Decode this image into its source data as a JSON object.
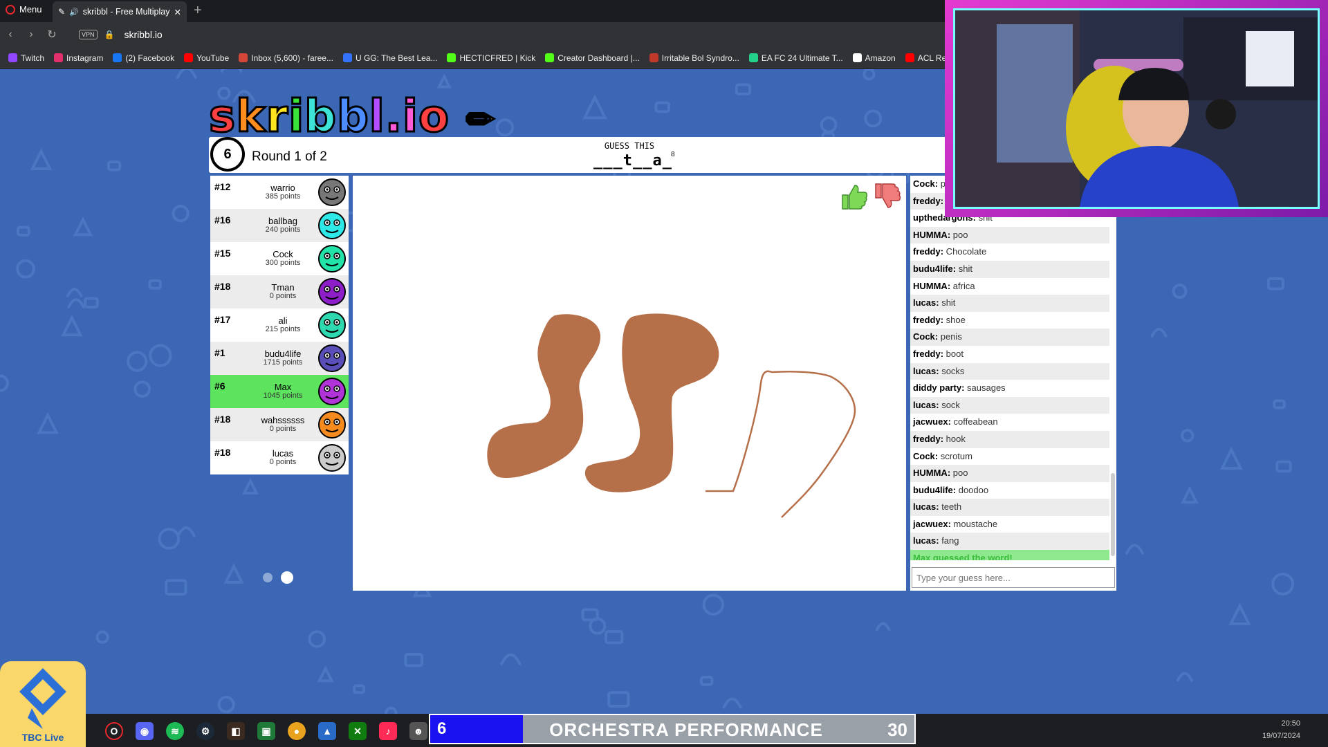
{
  "browser": {
    "menu_label": "Menu",
    "tab_title": "skribbl - Free Multiplay",
    "url": "skribbl.io",
    "vpn_label": "VPN",
    "bookmarks": [
      {
        "label": "Twitch",
        "color": "#9146ff"
      },
      {
        "label": "Instagram",
        "color": "#e1306c"
      },
      {
        "label": "(2) Facebook",
        "color": "#1877f2"
      },
      {
        "label": "YouTube",
        "color": "#ff0000"
      },
      {
        "label": "Inbox (5,600) - faree...",
        "color": "#d44638"
      },
      {
        "label": "U GG: The Best Lea...",
        "color": "#3273fa"
      },
      {
        "label": "HECTICFRED | Kick",
        "color": "#53fc18"
      },
      {
        "label": "Creator Dashboard |...",
        "color": "#53fc18"
      },
      {
        "label": "Irritable Bol Syndro...",
        "color": "#c0392b"
      },
      {
        "label": "EA FC 24 Ultimate T...",
        "color": "#23d18b"
      },
      {
        "label": "Amazon",
        "color": "#ffffff"
      },
      {
        "label": "ACL Reco",
        "color": "#ff0000"
      }
    ]
  },
  "game": {
    "logo": "skribbl.io",
    "timer": "6",
    "round_text": "Round 1 of 2",
    "guess_label": "GUESS THIS",
    "word_hint": "___t__a_",
    "word_length": "8",
    "players": [
      {
        "rank": "#12",
        "name": "warrio",
        "score": "385 points",
        "avatar_color": "#777777",
        "guessed": false
      },
      {
        "rank": "#16",
        "name": "ballbag",
        "score": "240 points",
        "avatar_color": "#2ee8e8",
        "guessed": false
      },
      {
        "rank": "#15",
        "name": "Cock",
        "score": "300 points",
        "avatar_color": "#22e3a8",
        "guessed": false
      },
      {
        "rank": "#18",
        "name": "Tman",
        "score": "0 points",
        "avatar_color": "#8c1fc8",
        "guessed": false
      },
      {
        "rank": "#17",
        "name": "ali",
        "score": "215 points",
        "avatar_color": "#2ed9b0",
        "guessed": false
      },
      {
        "rank": "#1",
        "name": "budu4life",
        "score": "1715 points",
        "avatar_color": "#5a4fb8",
        "guessed": false
      },
      {
        "rank": "#6",
        "name": "Max",
        "score": "1045 points",
        "avatar_color": "#b033d8",
        "guessed": true
      },
      {
        "rank": "#18",
        "name": "wahssssss",
        "score": "0 points",
        "avatar_color": "#f58a1f",
        "guessed": false
      },
      {
        "rank": "#18",
        "name": "lucas",
        "score": "0 points",
        "avatar_color": "#cccccc",
        "guessed": false
      }
    ],
    "chat": [
      {
        "name": "Cock:",
        "text": " p"
      },
      {
        "name": "freddy:",
        "text": ""
      },
      {
        "name": "upthedargons:",
        "text": " shit"
      },
      {
        "name": "HUMMA:",
        "text": " poo"
      },
      {
        "name": "freddy:",
        "text": " Chocolate"
      },
      {
        "name": "budu4life:",
        "text": " shit"
      },
      {
        "name": "HUMMA:",
        "text": " africa"
      },
      {
        "name": "lucas:",
        "text": " shit"
      },
      {
        "name": "freddy:",
        "text": " shoe"
      },
      {
        "name": "Cock:",
        "text": " penis"
      },
      {
        "name": "freddy:",
        "text": " boot"
      },
      {
        "name": "lucas:",
        "text": " socks"
      },
      {
        "name": "diddy party:",
        "text": " sausages"
      },
      {
        "name": "lucas:",
        "text": " sock"
      },
      {
        "name": "jacwuex:",
        "text": " coffeabean"
      },
      {
        "name": "freddy:",
        "text": " hook"
      },
      {
        "name": "Cock:",
        "text": " scrotum"
      },
      {
        "name": "HUMMA:",
        "text": " poo"
      },
      {
        "name": "budu4life:",
        "text": " doodoo"
      },
      {
        "name": "lucas:",
        "text": " teeth"
      },
      {
        "name": "jacwuex:",
        "text": " moustache"
      },
      {
        "name": "lucas:",
        "text": " fang"
      }
    ],
    "system_message": "Max guessed the word!",
    "chat_placeholder": "Type your guess here...",
    "drawing_color": "#b5704a"
  },
  "taskbar": {
    "badge_label": "TBC Live",
    "ticker_number": "6",
    "ticker_title": "ORCHESTRA PERFORMANCE",
    "ticker_count": "30",
    "time": "20:50",
    "date": "19/07/2024"
  }
}
